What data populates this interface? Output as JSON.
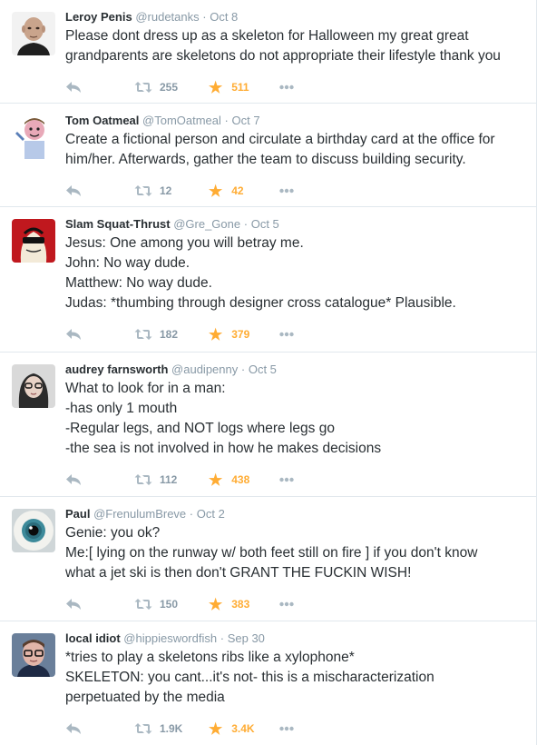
{
  "tweets": [
    {
      "name": "Leroy Penis",
      "handle": "@rudetanks",
      "sep": "·",
      "time": "Oct 8",
      "lines": [
        "Please dont dress up as a skeleton for Halloween my great great",
        "grandparents are skeletons do not appropriate their lifestyle thank you"
      ],
      "retweets": "255",
      "favorites": "511"
    },
    {
      "name": "Tom Oatmeal",
      "handle": "@TomOatmeal",
      "sep": "·",
      "time": "Oct 7",
      "lines": [
        "Create a fictional person and circulate a birthday card at the office for",
        "him/her. Afterwards, gather the team to discuss building security."
      ],
      "retweets": "12",
      "favorites": "42"
    },
    {
      "name": "Slam Squat-Thrust",
      "handle": "@Gre_Gone",
      "sep": "·",
      "time": "Oct 5",
      "lines": [
        "Jesus: One among you will betray me.",
        "John: No way dude.",
        "Matthew: No way dude.",
        "Judas: *thumbing through designer cross catalogue* Plausible."
      ],
      "retweets": "182",
      "favorites": "379"
    },
    {
      "name": "audrey farnsworth",
      "handle": "@audipenny",
      "sep": "·",
      "time": "Oct 5",
      "lines": [
        "What to look for in a man:",
        "-has only 1 mouth",
        "-Regular legs, and NOT logs where legs go",
        "-the sea is not involved in how he makes decisions"
      ],
      "retweets": "112",
      "favorites": "438"
    },
    {
      "name": "Paul",
      "handle": "@FrenulumBreve",
      "sep": "·",
      "time": "Oct 2",
      "lines": [
        "Genie: you ok?",
        "Me:[ lying on the runway w/ both feet still on fire ] if you don't know",
        "what a jet ski is then don't GRANT THE FUCKIN WISH!"
      ],
      "retweets": "150",
      "favorites": "383"
    },
    {
      "name": "local idiot",
      "handle": "@hippieswordfish",
      "sep": "·",
      "time": "Sep 30",
      "lines": [
        "*tries to play a skeletons ribs like a xylophone*",
        "SKELETON: you cant...it's not- this is a mischaracterization",
        "perpetuated by the media"
      ],
      "retweets": "1.9K",
      "favorites": "3.4K"
    }
  ],
  "icons": {
    "reply": "reply-arrow-icon",
    "retweet": "retweet-icon",
    "favorite": "star-icon",
    "more": "ellipsis-icon"
  },
  "colors": {
    "name": "#292f33",
    "meta": "#8899a6",
    "favorite": "#ffac33",
    "divider": "#e1e8ed"
  }
}
